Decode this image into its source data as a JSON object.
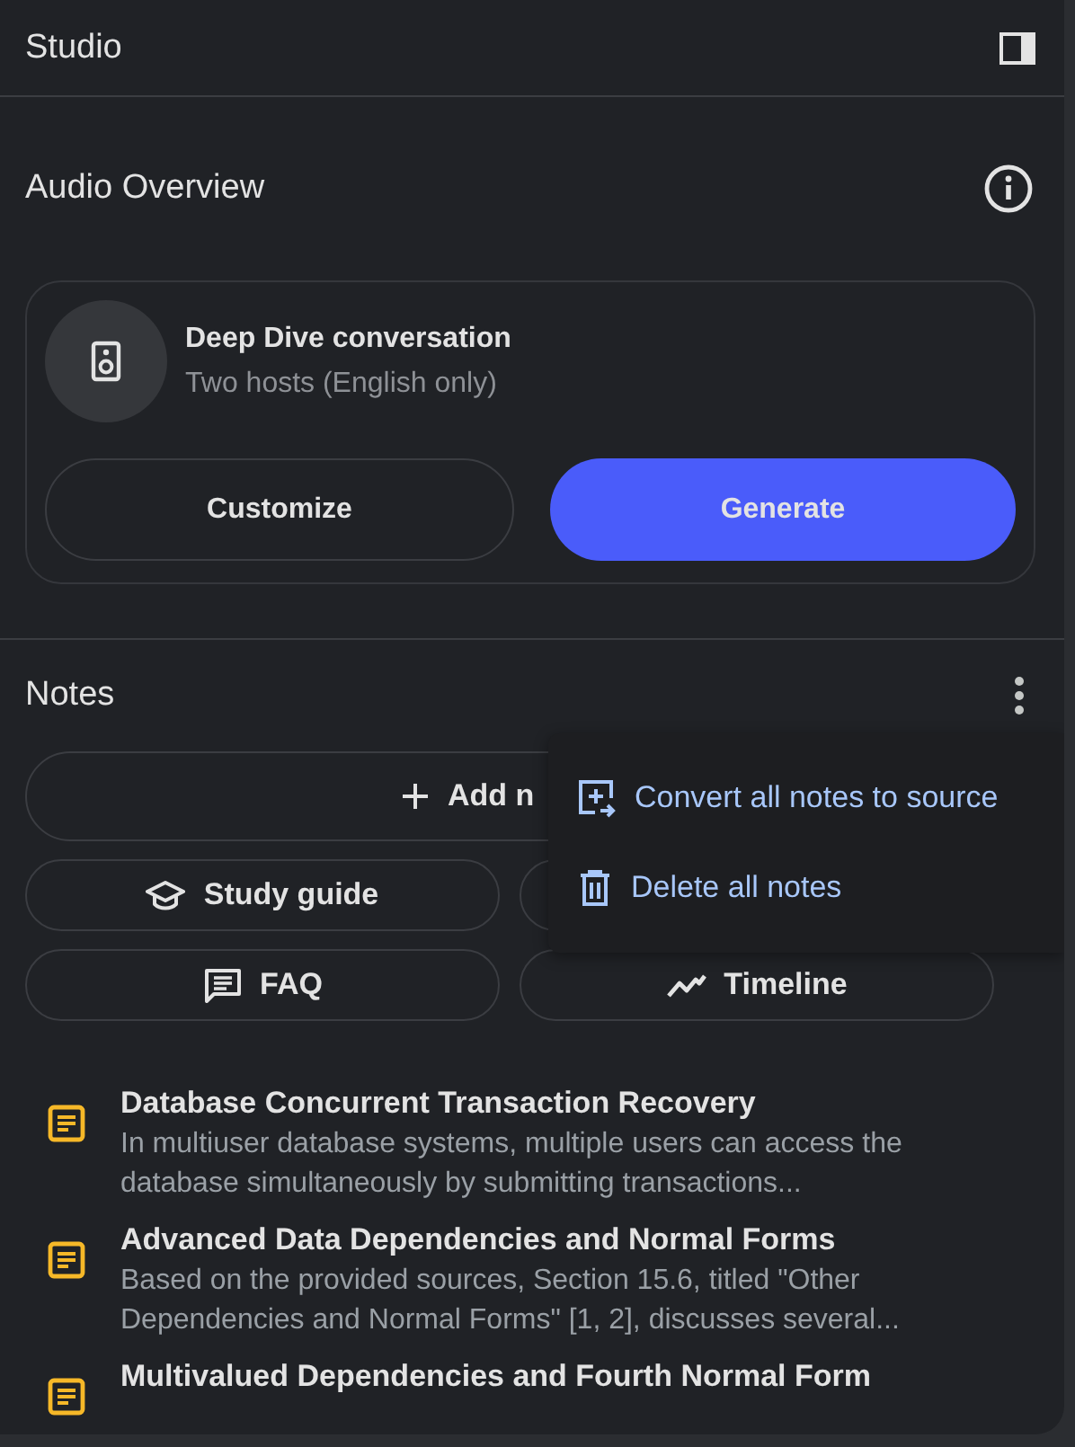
{
  "panel": {
    "title": "Studio"
  },
  "audio_overview": {
    "title": "Audio Overview",
    "card": {
      "title": "Deep Dive conversation",
      "subtitle": "Two hosts (English only)"
    },
    "buttons": [
      {
        "label": "Customize",
        "kind": "outline"
      },
      {
        "label": "Generate",
        "kind": "primary"
      }
    ]
  },
  "notes": {
    "title": "Notes",
    "add_button": {
      "label": "Add n"
    },
    "chips": [
      {
        "kind": "chip",
        "label": "Study guide"
      },
      {
        "kind": "covered"
      },
      {
        "kind": "chip",
        "label": "FAQ"
      },
      {
        "kind": "chip",
        "label": "Timeline"
      }
    ],
    "items": [
      {
        "title": "Database Concurrent Transaction Recovery",
        "body": "In multiuser database systems, multiple users can access the database simultaneously by submitting transactions..."
      },
      {
        "title": "Advanced Data Dependencies and Normal Forms",
        "body": "Based on the provided sources, Section 15.6, titled \"Other Dependencies and Normal Forms\" [1, 2], discusses several..."
      },
      {
        "title": "Multivalued Dependencies and Fourth Normal Form"
      }
    ]
  },
  "menu": {
    "items": [
      {
        "label": "Convert all notes to source"
      },
      {
        "label": "Delete all notes"
      }
    ]
  }
}
